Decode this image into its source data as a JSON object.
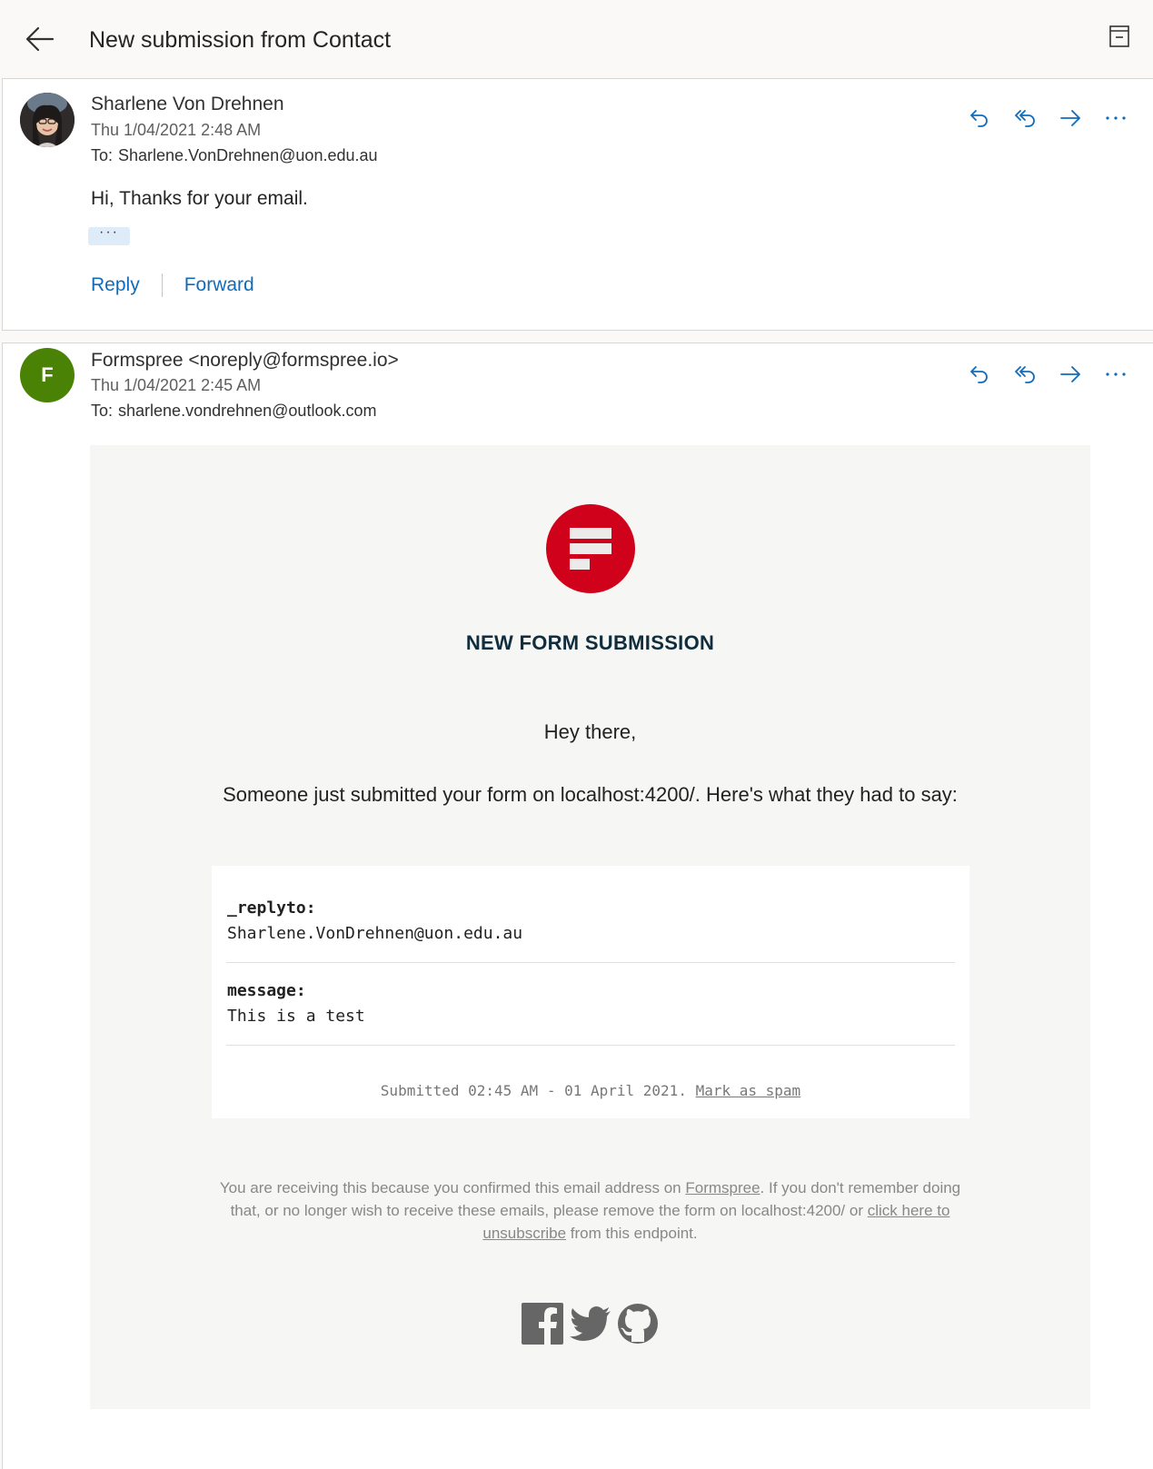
{
  "conversation": {
    "title": "New submission from Contact"
  },
  "messages": [
    {
      "sender": "Sharlene Von Drehnen",
      "date": "Thu 1/04/2021 2:48 AM",
      "to_label": "To:",
      "to": "Sharlene.VonDrehnen@uon.edu.au",
      "body": "Hi, Thanks for your email.",
      "expand_label": "···",
      "reply_label": "Reply",
      "forward_label": "Forward"
    },
    {
      "avatar_letter": "F",
      "sender": "Formspree <noreply@formspree.io>",
      "date": "Thu 1/04/2021 2:45 AM",
      "to_label": "To:",
      "to": "sharlene.vondrehnen@outlook.com"
    }
  ],
  "email": {
    "heading": "NEW FORM SUBMISSION",
    "greeting": "Hey there,",
    "intro": "Someone just submitted your form on localhost:4200/. Here's what they had to say:",
    "fields": [
      {
        "name": "_replyto:",
        "value": "Sharlene.VonDrehnen@uon.edu.au"
      },
      {
        "name": "message:",
        "value": "This is a test"
      }
    ],
    "submitted": "Submitted 02:45 AM - 01 April 2021.",
    "mark_spam": "Mark as spam",
    "footer": {
      "part1": "You are receiving this because you confirmed this email address on ",
      "link1": "Formspree",
      "part2": ". If you don't remember doing that, or no longer wish to receive these emails, please remove the form on localhost:4200/ or ",
      "link2": "click here to unsubscribe",
      "part3": " from this endpoint."
    }
  },
  "icons": {
    "back": "arrow-left-icon",
    "popout": "popout-icon",
    "reply": "reply-icon",
    "reply_all": "reply-all-icon",
    "forward": "forward-icon",
    "more": "more-icon",
    "facebook": "facebook-icon",
    "twitter": "twitter-icon",
    "github": "github-icon"
  },
  "colors": {
    "accent": "#0f6cbd",
    "formspree_red": "#d0021b",
    "avatar_green": "#498205"
  }
}
